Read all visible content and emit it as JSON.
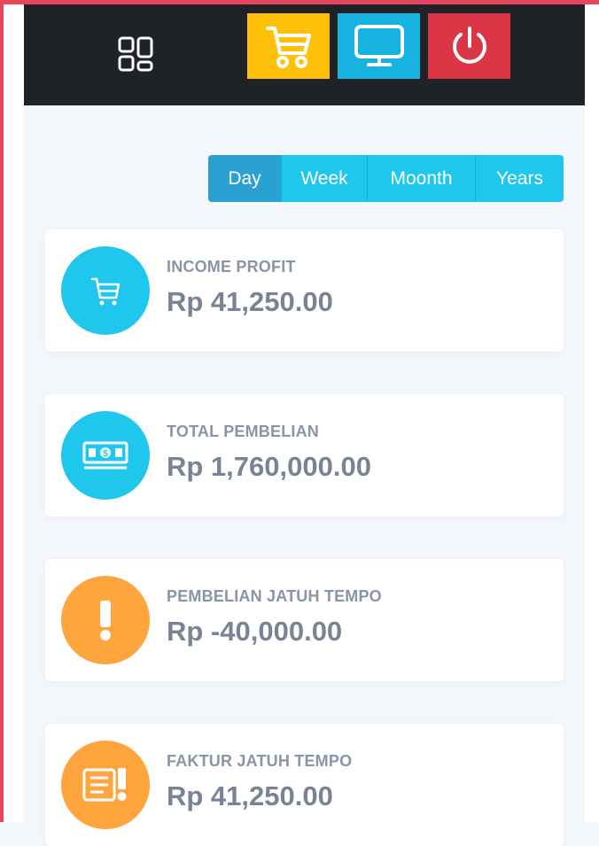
{
  "colors": {
    "frame": "#e8455e",
    "topbar": "#1f2227",
    "cart_button": "#ffc107",
    "monitor_button": "#17b3e0",
    "power_button": "#dc3545",
    "range_active": "#2aa1d0",
    "range_default": "#1fc7ec",
    "info": "#1fc7ec",
    "warning": "#ffa53d"
  },
  "toolbar": {
    "icons": [
      "dashboard-grid-icon",
      "cart-icon",
      "monitor-icon",
      "power-icon"
    ]
  },
  "range_tabs": [
    {
      "label": "Day",
      "active": true
    },
    {
      "label": "Week",
      "active": false
    },
    {
      "label": "Moonth",
      "active": false
    },
    {
      "label": "Years",
      "active": false
    }
  ],
  "cards": [
    {
      "label": "INCOME PROFIT",
      "value": "Rp 41,250.00",
      "icon": "cart-icon",
      "color": "#1fc7ec"
    },
    {
      "label": "TOTAL PEMBELIAN",
      "value": "Rp 1,760,000.00",
      "icon": "money-icon",
      "color": "#1fc7ec"
    },
    {
      "label": "PEMBELIAN JATUH TEMPO",
      "value": "Rp -40,000.00",
      "icon": "exclamation-icon",
      "color": "#ffa53d"
    },
    {
      "label": "FAKTUR JATUH TEMPO",
      "value": "Rp 41,250.00",
      "icon": "invoice-alert-icon",
      "color": "#ffa53d"
    }
  ]
}
